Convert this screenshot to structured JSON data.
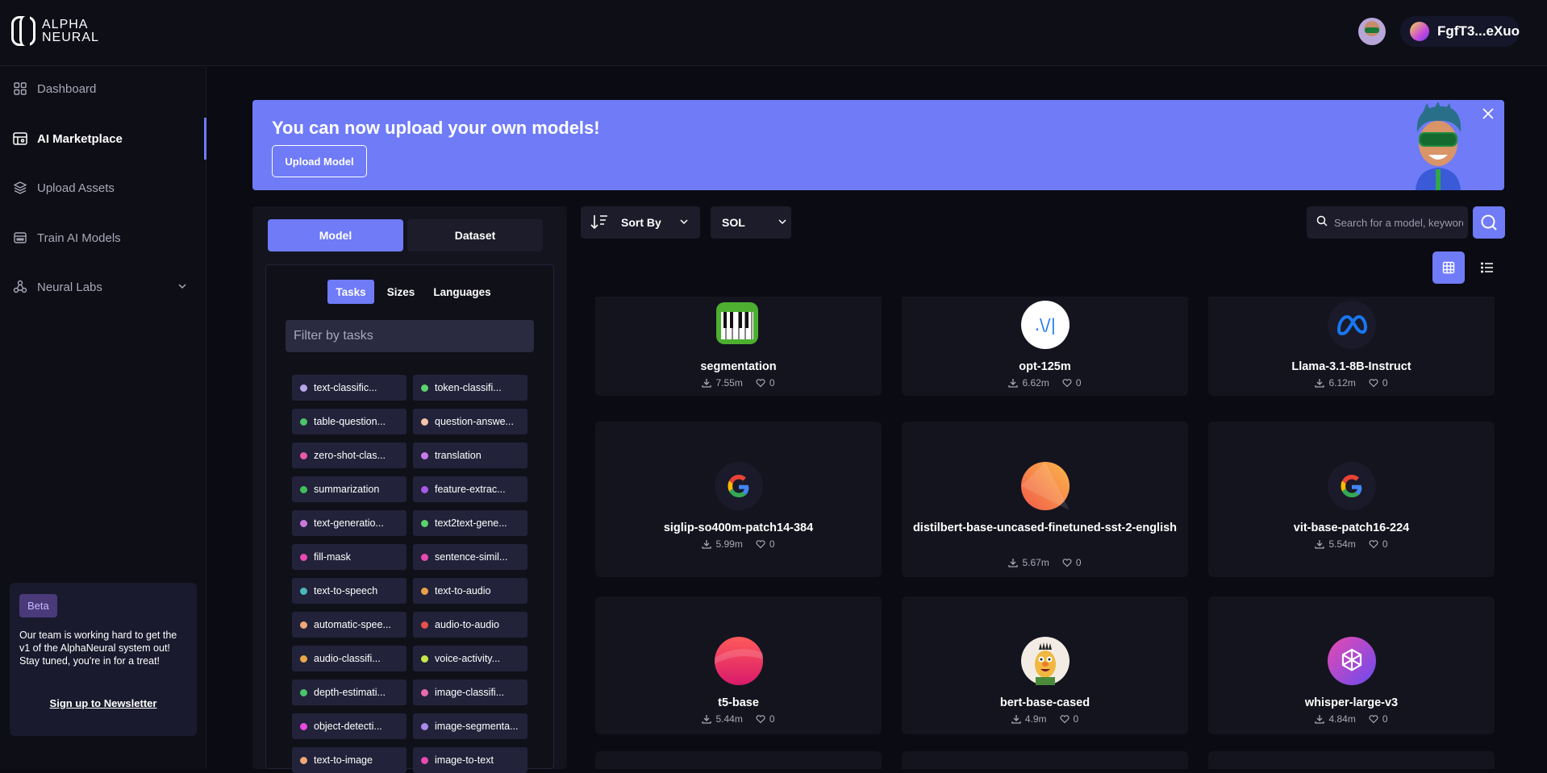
{
  "header": {
    "logo_line1": "ALPHA",
    "logo_line2": "NEURAL",
    "wallet_label": "FgfT3...eXuo"
  },
  "sidebar": {
    "items": [
      {
        "label": "Dashboard",
        "icon": "grid-icon"
      },
      {
        "label": "AI Marketplace",
        "icon": "marketplace-icon",
        "active": true
      },
      {
        "label": "Upload Assets",
        "icon": "layers-icon"
      },
      {
        "label": "Train AI Models",
        "icon": "train-icon"
      },
      {
        "label": "Neural Labs",
        "icon": "flask-icon"
      }
    ],
    "beta": {
      "badge": "Beta",
      "text": "Our team is working hard to get the v1 of the AlphaNeural system out! Stay tuned, you're in for a treat!",
      "link": "Sign up to Newsletter"
    }
  },
  "banner": {
    "title": "You can now upload your own models!",
    "button": "Upload Model"
  },
  "filters": {
    "tabs": [
      "Model",
      "Dataset"
    ],
    "subtabs": [
      "Tasks",
      "Sizes",
      "Languages"
    ],
    "placeholder": "Filter by tasks",
    "chips": [
      {
        "label": "text-classific...",
        "color": "#b9a6e8"
      },
      {
        "label": "token-classifi...",
        "color": "#5ad36a"
      },
      {
        "label": "table-question...",
        "color": "#4cc46a"
      },
      {
        "label": "question-answe...",
        "color": "#f0c4a8"
      },
      {
        "label": "zero-shot-clas...",
        "color": "#e85aa8"
      },
      {
        "label": "translation",
        "color": "#c77ae8"
      },
      {
        "label": "summarization",
        "color": "#3fbf5a"
      },
      {
        "label": "feature-extrac...",
        "color": "#a85ae8"
      },
      {
        "label": "text-generatio...",
        "color": "#c97ad8"
      },
      {
        "label": "text2text-gene...",
        "color": "#5ad36a"
      },
      {
        "label": "fill-mask",
        "color": "#e84ab0"
      },
      {
        "label": "sentence-simil...",
        "color": "#e84ab0"
      },
      {
        "label": "text-to-speech",
        "color": "#4ab8b8"
      },
      {
        "label": "text-to-audio",
        "color": "#e8a04a"
      },
      {
        "label": "automatic-spee...",
        "color": "#f0a878"
      },
      {
        "label": "audio-to-audio",
        "color": "#e8504a"
      },
      {
        "label": "audio-classifi...",
        "color": "#e8a84a"
      },
      {
        "label": "voice-activity...",
        "color": "#c8e84a"
      },
      {
        "label": "depth-estimati...",
        "color": "#4ac46a"
      },
      {
        "label": "image-classifi...",
        "color": "#e86ab0"
      },
      {
        "label": "object-detecti...",
        "color": "#e84ae0"
      },
      {
        "label": "image-segmenta...",
        "color": "#a88ae8"
      },
      {
        "label": "text-to-image",
        "color": "#f0a878"
      },
      {
        "label": "image-to-text",
        "color": "#e84ab0"
      }
    ]
  },
  "toolbar": {
    "sort_label": "Sort By",
    "currency": "SOL",
    "search_placeholder": "Search for a model, keyword"
  },
  "models": [
    {
      "name": "segmentation",
      "downloads": "7.55m",
      "likes": "0",
      "logo": "pyannote-logo"
    },
    {
      "name": "opt-125m",
      "downloads": "6.62m",
      "likes": "0",
      "logo": "meta-ai-logo"
    },
    {
      "name": "Llama-3.1-8B-Instruct",
      "downloads": "6.12m",
      "likes": "0",
      "logo": "meta-logo"
    },
    {
      "name": "siglip-so400m-patch14-384",
      "downloads": "5.99m",
      "likes": "0",
      "logo": "google-logo"
    },
    {
      "name": "distilbert-base-uncased-finetuned-sst-2-english",
      "downloads": "5.67m",
      "likes": "0",
      "logo": "orange-gradient-logo"
    },
    {
      "name": "vit-base-patch16-224",
      "downloads": "5.54m",
      "likes": "0",
      "logo": "google-logo"
    },
    {
      "name": "t5-base",
      "downloads": "5.44m",
      "likes": "0",
      "logo": "red-gradient-logo"
    },
    {
      "name": "bert-base-cased",
      "downloads": "4.9m",
      "likes": "0",
      "logo": "bert-muppet-logo"
    },
    {
      "name": "whisper-large-v3",
      "downloads": "4.84m",
      "likes": "0",
      "logo": "openai-logo"
    }
  ],
  "colors": {
    "accent": "#6f7bf7",
    "background": "#0b0b13",
    "panel": "#14141f"
  }
}
